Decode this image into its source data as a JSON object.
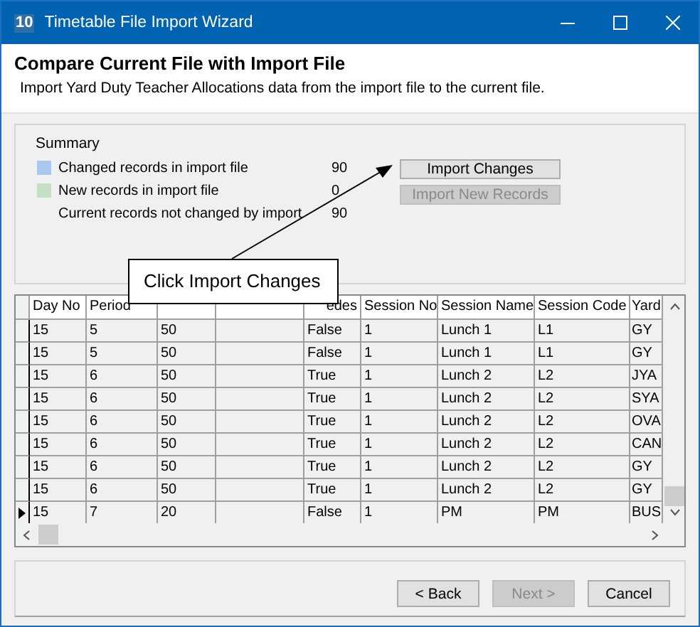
{
  "window": {
    "title": "Timetable File Import Wizard",
    "icon_text": "10"
  },
  "header": {
    "title": "Compare Current File with Import File",
    "subtitle": "Import Yard Duty Teacher Allocations data from the import file to the current file."
  },
  "summary": {
    "title": "Summary",
    "items": [
      {
        "label": "Changed records in import file",
        "count": "90",
        "color": "#a8c8ef"
      },
      {
        "label": "New records in import file",
        "count": "0",
        "color": "#c4e0c4"
      },
      {
        "label": "Current records not changed by import",
        "count": "90"
      }
    ],
    "buttons": [
      {
        "label": "Import Changes",
        "disabled": false
      },
      {
        "label": "Import New Records",
        "disabled": true
      }
    ]
  },
  "callout": {
    "text": "Click Import Changes"
  },
  "table": {
    "columns": [
      {
        "label": "Day No"
      },
      {
        "label": "Period"
      },
      {},
      {},
      {
        "label": "edes"
      },
      {
        "label": "Session No"
      },
      {
        "label": "Session Name"
      },
      {
        "label": "Session Code"
      },
      {
        "label": "Yard"
      }
    ],
    "rows": [
      {
        "current": false,
        "cells": [
          "15",
          "5",
          "50",
          "",
          "False",
          "1",
          "Lunch 1",
          "L1",
          "GY"
        ]
      },
      {
        "current": false,
        "cells": [
          "15",
          "5",
          "50",
          "",
          "False",
          "1",
          "Lunch 1",
          "L1",
          "GY"
        ]
      },
      {
        "current": false,
        "cells": [
          "15",
          "6",
          "50",
          "",
          "True",
          "1",
          "Lunch 2",
          "L2",
          "JYA"
        ]
      },
      {
        "current": false,
        "cells": [
          "15",
          "6",
          "50",
          "",
          "True",
          "1",
          "Lunch 2",
          "L2",
          "SYA"
        ]
      },
      {
        "current": false,
        "cells": [
          "15",
          "6",
          "50",
          "",
          "True",
          "1",
          "Lunch 2",
          "L2",
          "OVA"
        ]
      },
      {
        "current": false,
        "cells": [
          "15",
          "6",
          "50",
          "",
          "True",
          "1",
          "Lunch 2",
          "L2",
          "CAN"
        ]
      },
      {
        "current": false,
        "cells": [
          "15",
          "6",
          "50",
          "",
          "True",
          "1",
          "Lunch 2",
          "L2",
          "GY"
        ]
      },
      {
        "current": false,
        "cells": [
          "15",
          "6",
          "50",
          "",
          "True",
          "1",
          "Lunch 2",
          "L2",
          "GY"
        ]
      },
      {
        "current": true,
        "cells": [
          "15",
          "7",
          "20",
          "",
          "False",
          "1",
          "PM",
          "PM",
          "BUS"
        ]
      }
    ]
  },
  "footer": {
    "buttons": [
      {
        "label": "< Back",
        "disabled": false
      },
      {
        "label": "Next >",
        "disabled": true
      },
      {
        "label": "Cancel",
        "disabled": false
      }
    ]
  }
}
